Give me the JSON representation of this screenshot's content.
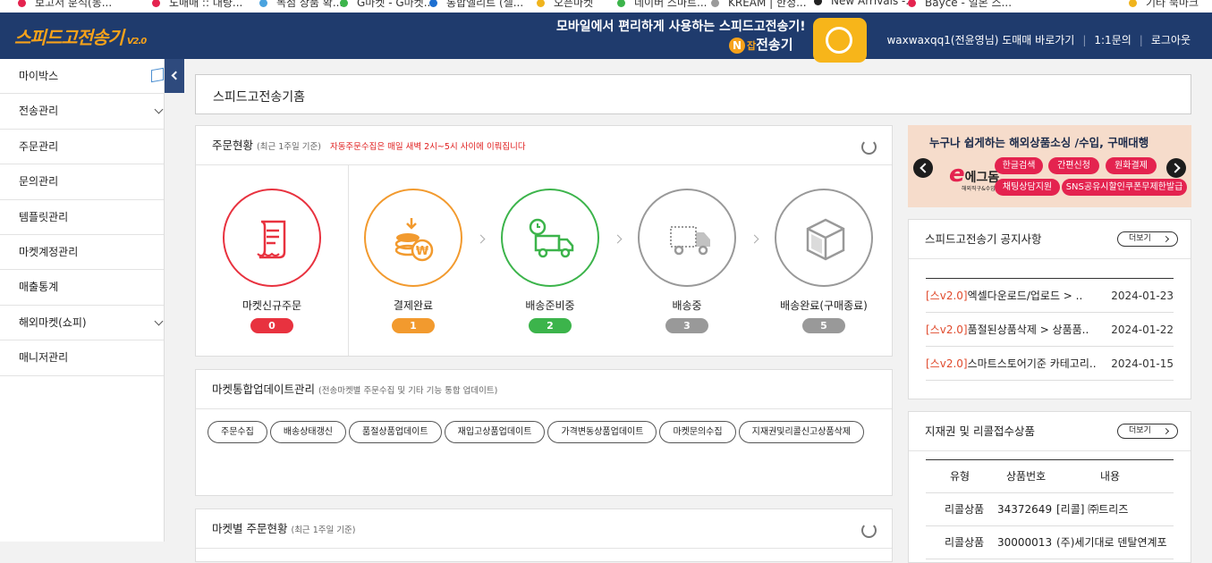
{
  "bookmarks": [
    {
      "label": "보고서 분석(동...",
      "color": "#e4234f"
    },
    {
      "label": "도매매 :: 대량...",
      "color": "#e4234f"
    },
    {
      "label": "독점 상품 확...",
      "color": "#4aa3df"
    },
    {
      "label": "G마켓 - G마켓...",
      "color": "#3cb44b"
    },
    {
      "label": "통합엘리트 (셀...",
      "color": "#1d6fd1"
    },
    {
      "label": "오픈마켓",
      "color": "#f0b41d"
    },
    {
      "label": "네이버 스마트...",
      "color": "#3cb44b"
    },
    {
      "label": "KREAM | 한정...",
      "color": "#9a9a9a"
    },
    {
      "label": "New Arrivals -...",
      "color": "#222222"
    },
    {
      "label": "Bayce - 일본 스...",
      "color": "#e4234f"
    },
    {
      "label": "기타 북마크",
      "color": "#f0b41d"
    }
  ],
  "header": {
    "logo": "스피드고전송기",
    "version": "V2.0",
    "promo_line": "모바일에서 편리하게 사용하는 스피드고전송기!",
    "promo_brand_prefix": "잡",
    "promo_brand": "전송기",
    "user": "waxwaxqq1(전윤영님) 도매매 바로가기",
    "inquiry": "1:1문의",
    "logout": "로그아웃",
    "brand_color": "#1f3b6d",
    "accent_color": "#f7a21a"
  },
  "sidebar": {
    "items": [
      {
        "label": "마이박스",
        "icon": "cube-icon"
      },
      {
        "label": "전송관리",
        "icon": "chevron-down-icon"
      },
      {
        "label": "주문관리",
        "icon": ""
      },
      {
        "label": "문의관리",
        "icon": ""
      },
      {
        "label": "템플릿관리",
        "icon": ""
      },
      {
        "label": "마켓계정관리",
        "icon": ""
      },
      {
        "label": "매출통계",
        "icon": ""
      },
      {
        "label": "해외마켓(쇼피)",
        "icon": "chevron-down-icon"
      },
      {
        "label": "매니저관리",
        "icon": ""
      }
    ]
  },
  "main": {
    "title": "스피드고전송기홈"
  },
  "order_status": {
    "title": "주문현황",
    "period": "(최근 1주일 기준)",
    "note": "자동주문수집은 매일 새벽 2시~5시 사이에 이뤄집니다",
    "stages": [
      {
        "label": "마켓신규주문",
        "count": "0",
        "color": "#e8323f",
        "icon": "receipt-icon"
      },
      {
        "label": "결제완료",
        "count": "1",
        "color": "#f29a2e",
        "icon": "coins-icon"
      },
      {
        "label": "배송준비중",
        "count": "2",
        "color": "#3cb44b",
        "icon": "truck-clock-icon"
      },
      {
        "label": "배송중",
        "count": "3",
        "color": "#999999",
        "icon": "truck-icon"
      },
      {
        "label": "배송완료(구매종료)",
        "count": "5",
        "color": "#999999",
        "icon": "box-icon"
      }
    ]
  },
  "market_update": {
    "title": "마켓통합업데이트관리",
    "sub": "(전송마켓별 주문수집 및 기타 기능 통합 업데이트)",
    "buttons": [
      "주문수집",
      "배송상태갱신",
      "품절상품업데이트",
      "재입고상품업데이트",
      "가격변동상품업데이트",
      "마켓문의수집",
      "지재권및리콜신고상품삭제"
    ]
  },
  "market_orders": {
    "title": "마켓별 주문현황",
    "period": "(최근 1주일 기준)"
  },
  "banner": {
    "title": "누구나 쉽게하는 해외상품소싱 /수입, 구매대행",
    "brand_e": "e",
    "brand": "에그돔",
    "brand_sub": "해외직구&수입지원",
    "tags": [
      "한글검색",
      "간편신청",
      "원화결제",
      "채팅상담지원",
      "SNS공유시할인쿠폰무제한발급"
    ]
  },
  "notices": {
    "title": "스피드고전송기 공지사항",
    "more": "더보기",
    "items": [
      {
        "tag": "[스v2.0]",
        "text": "엑셀다운로드/업로드 > ..",
        "date": "2024-01-23"
      },
      {
        "tag": "[스v2.0]",
        "text": "품절된상품삭제 > 상품품..",
        "date": "2024-01-22"
      },
      {
        "tag": "[스v2.0]",
        "text": "스마트스토어기준 카테고리..",
        "date": "2024-01-15"
      }
    ]
  },
  "ip_products": {
    "title": "지재권 및 리콜접수상품",
    "more": "더보기",
    "headers": [
      "유형",
      "상품번호",
      "내용"
    ],
    "rows": [
      [
        "리콜상품",
        "34372649",
        "[리콜] ㈜트리즈"
      ],
      [
        "리콜상품",
        "30000013",
        "(주)세기대로 덴탈연계포"
      ]
    ]
  }
}
